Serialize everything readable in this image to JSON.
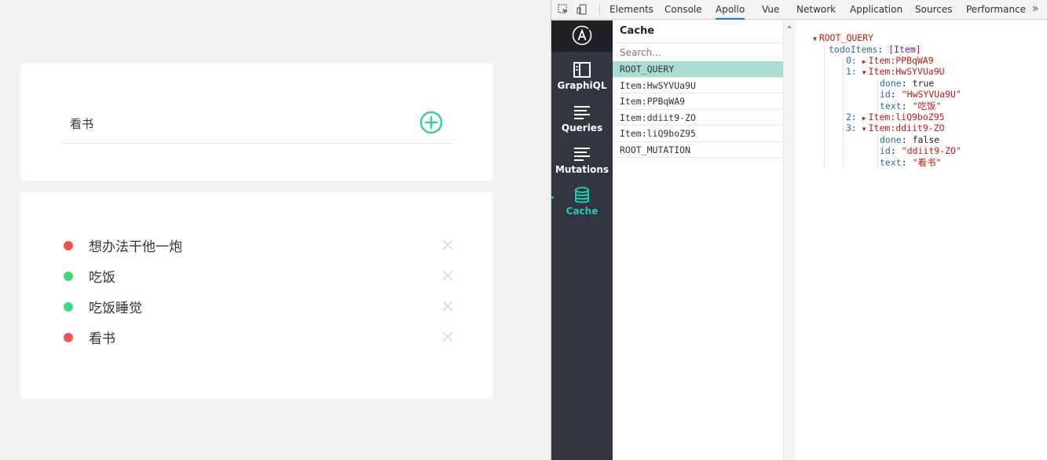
{
  "app": {
    "input_value": "看书",
    "todos": [
      {
        "text": "想办法干他一炮",
        "done": false
      },
      {
        "text": "吃饭",
        "done": true
      },
      {
        "text": "吃饭睡觉",
        "done": true
      },
      {
        "text": "看书",
        "done": false
      }
    ]
  },
  "colors": {
    "done": "#3fd881",
    "not_done": "#f25454",
    "add_button": "#3ecf8e",
    "delete_icon": "#e0e0e0",
    "accent": "#22c9b5"
  },
  "devtools": {
    "tabs": [
      "Elements",
      "Console",
      "Apollo",
      "Vue",
      "Network",
      "Application",
      "Sources",
      "Performance"
    ],
    "active_tab": "Apollo",
    "more": "»",
    "apollo": {
      "nav": [
        "GraphiQL",
        "Queries",
        "Mutations",
        "Cache"
      ],
      "active_nav": "Cache",
      "cache_title": "Cache",
      "search_placeholder": "Search...",
      "cache_items": [
        "ROOT_QUERY",
        "Item:HwSYVUa9U",
        "Item:PPBqWA9",
        "Item:ddiit9-ZO",
        "Item:liQ9boZ95",
        "ROOT_MUTATION"
      ],
      "selected_item": "ROOT_QUERY",
      "detail": {
        "root": "ROOT_QUERY",
        "field": "todoItems",
        "field_type": "[Item]",
        "items": [
          {
            "index": "0:",
            "ref": "Item:PPBqWA9",
            "expanded": false
          },
          {
            "index": "1:",
            "ref": "Item:HwSYVUa9U",
            "expanded": true,
            "done": "true",
            "id": "\"HwSYVUa9U\"",
            "text": "\"吃饭\""
          },
          {
            "index": "2:",
            "ref": "Item:liQ9boZ95",
            "expanded": false
          },
          {
            "index": "3:",
            "ref": "Item:ddiit9-ZO",
            "expanded": true,
            "done": "false",
            "id": "\"ddiit9-ZO\"",
            "text": "\"看书\""
          }
        ],
        "labels": {
          "done": "done",
          "id": "id",
          "text": "text"
        }
      }
    }
  }
}
